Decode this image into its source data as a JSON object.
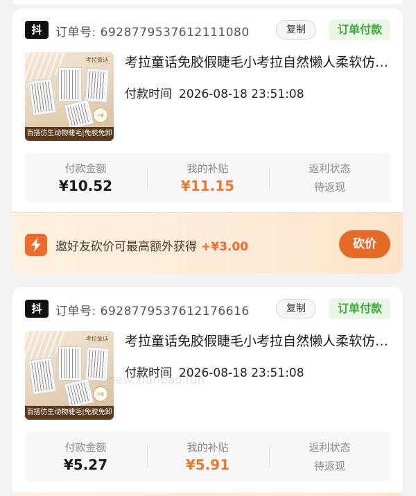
{
  "platform_badge": "抖",
  "orders": [
    {
      "order_no_label": "订单号:",
      "order_no": "6928779537612111080",
      "copy_label": "复制",
      "status": "订单付款",
      "product_title": "考拉童话免胶假睫毛小考拉自然懒人柔软仿生动物睫毛",
      "thumb_caption": "百搭仿生动物睫毛|免胶免卸",
      "pay_time_label": "付款时间",
      "pay_time": "2026-08-18 23:51:08",
      "pay_amount_label": "付款金额",
      "pay_amount": "¥10.52",
      "subsidy_label": "我的补贴",
      "subsidy": "¥11.15",
      "rebate_label": "返利状态",
      "rebate_status": "待返现",
      "bargain_text": "邀好友砍价可最高额外获得",
      "bargain_bonus": "+¥3.00",
      "bargain_button": "砍价"
    },
    {
      "order_no_label": "订单号:",
      "order_no": "6928779537612176616",
      "copy_label": "复制",
      "status": "订单付款",
      "product_title": "考拉童话免胶假睫毛小考拉自然懒人柔软仿生动物睫毛",
      "thumb_caption": "百搭仿生动物睫毛|免胶免卸",
      "pay_time_label": "付款时间",
      "pay_time": "2026-08-18 23:51:08",
      "pay_amount_label": "付款金额",
      "pay_amount": "¥5.27",
      "subsidy_label": "我的补贴",
      "subsidy": "¥5.91",
      "rebate_label": "返利状态",
      "rebate_status": "待返现"
    }
  ],
  "watermark": "-new.xianbao.fun",
  "colors": {
    "status_green": "#3ea83a",
    "subsidy_orange": "#f07a2a",
    "bargain_button": "#e56a26"
  }
}
